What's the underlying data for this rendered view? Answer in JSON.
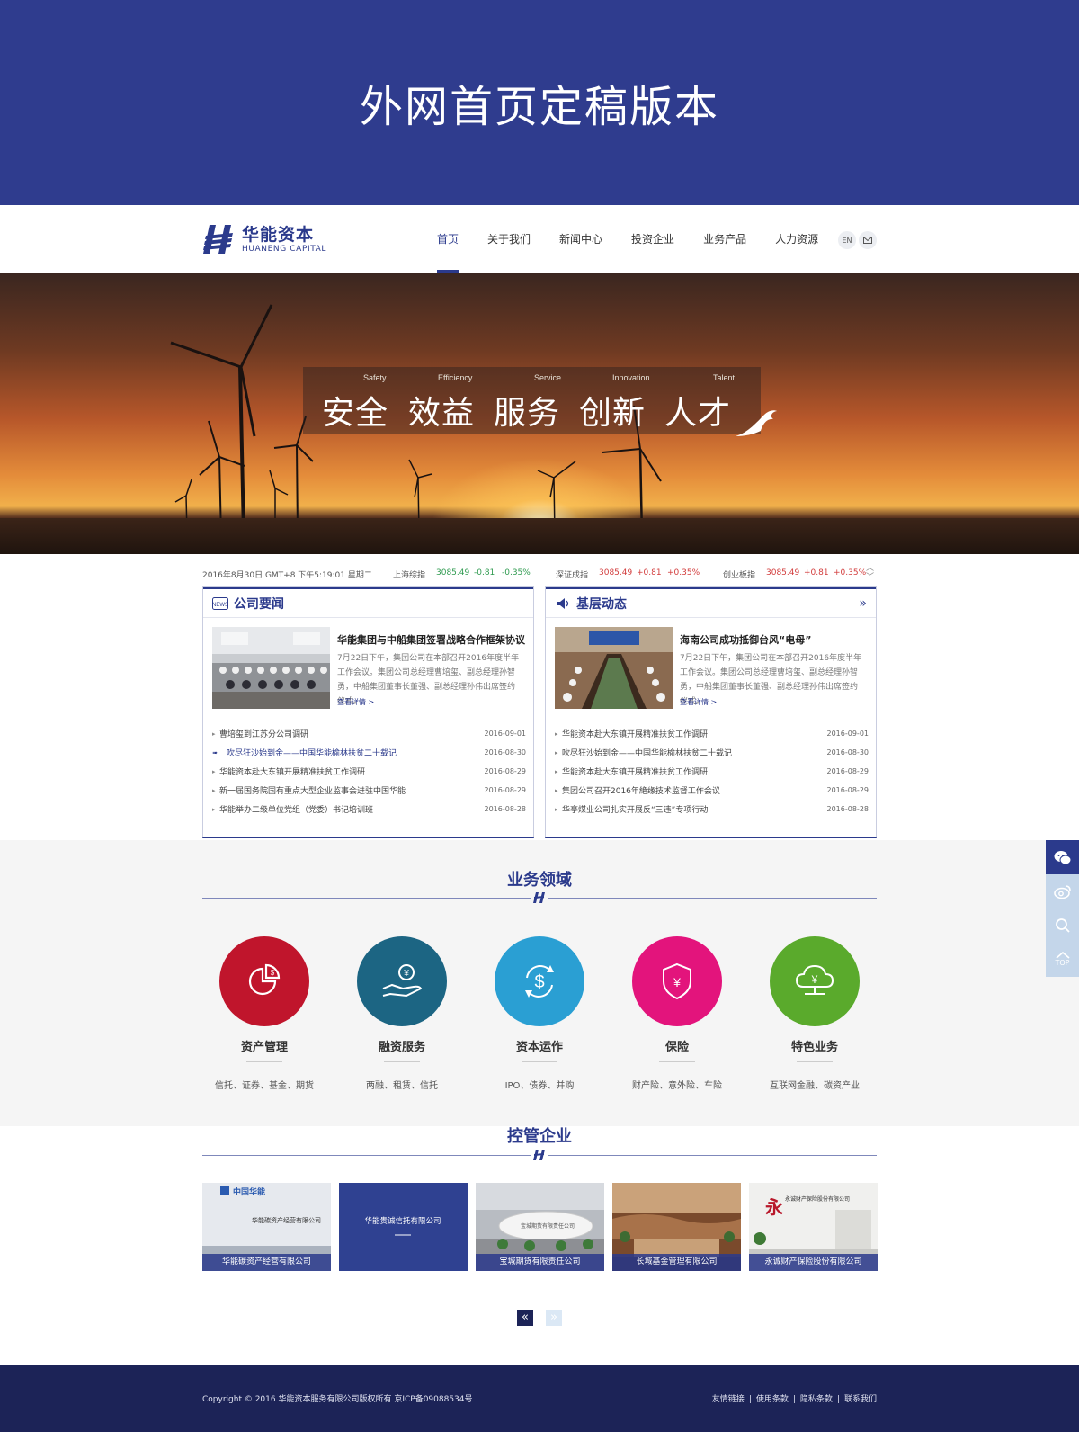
{
  "banner": {
    "title": "外网首页定稿版本"
  },
  "brand": {
    "name_cn": "华能资本",
    "name_en": "HUANENG CAPITAL",
    "color": "#2b3a8c"
  },
  "nav": {
    "items": [
      {
        "label": "首页",
        "active": true
      },
      {
        "label": "关于我们"
      },
      {
        "label": "新闻中心"
      },
      {
        "label": "投资企业"
      },
      {
        "label": "业务产品"
      },
      {
        "label": "人力资源"
      }
    ],
    "lang_label": "EN",
    "mail_icon": "mail-icon"
  },
  "hero": {
    "values": [
      {
        "en": "Safety",
        "cn": "安全"
      },
      {
        "en": "Efficiency",
        "cn": "效益"
      },
      {
        "en": "Service",
        "cn": "服务"
      },
      {
        "en": "Innovation",
        "cn": "创新"
      },
      {
        "en": "Talent",
        "cn": "人才"
      }
    ]
  },
  "ticker": {
    "datetime": "2016年8月30日  GMT+8  下午5:19:01  星期二",
    "indices": [
      {
        "name": "上海综指",
        "value": "3085.49",
        "change": "-0.81",
        "pct": "-0.35%",
        "trend": "down"
      },
      {
        "name": "深证成指",
        "value": "3085.49",
        "change": "+0.81",
        "pct": "+0.35%",
        "trend": "up"
      },
      {
        "name": "创业板指",
        "value": "3085.49",
        "change": "+0.81",
        "pct": "+0.35%",
        "trend": "up"
      }
    ]
  },
  "company_news": {
    "title": "公司要闻",
    "icon": "news-icon",
    "feature": {
      "title": "华能集团与中船集团签署战略合作框架协议",
      "body": "7月22日下午，集团公司在本部召开2016年度半年工作会议。集团公司总经理曹培玺、副总经理孙智勇，中船集团董事长董强、副总经理孙伟出席签约仪式。",
      "link": "查看详情  >"
    },
    "items": [
      {
        "title": "曹培玺到江苏分公司调研",
        "date": "2016-09-01"
      },
      {
        "title": "吹尽狂沙始到金——中国华能榆林扶贫二十载记",
        "date": "2016-08-30",
        "highlight": true
      },
      {
        "title": "华能资本赴大东镇开展精准扶贫工作调研",
        "date": "2016-08-29"
      },
      {
        "title": "新一届国务院国有重点大型企业监事会进驻中国华能",
        "date": "2016-08-29"
      },
      {
        "title": "华能举办二级单位党组（党委）书记培训班",
        "date": "2016-08-28"
      }
    ]
  },
  "grassroots_news": {
    "title": "基层动态",
    "icon": "speaker-icon",
    "more": "»",
    "feature": {
      "title": "海南公司成功抵御台风“电母”",
      "body": "7月22日下午，集团公司在本部召开2016年度半年工作会议。集团公司总经理曹培玺、副总经理孙智勇，中船集团董事长董强、副总经理孙伟出席签约仪式。",
      "link": "查看详情  >"
    },
    "items": [
      {
        "title": "华能资本赴大东镇开展精准扶贫工作调研",
        "date": "2016-09-01"
      },
      {
        "title": "吹尽狂沙始到金——中国华能榆林扶贫二十载记",
        "date": "2016-08-30"
      },
      {
        "title": "华能资本赴大东镇开展精准扶贫工作调研",
        "date": "2016-08-29"
      },
      {
        "title": "集团公司召开2016年絶缘技术监督工作会议",
        "date": "2016-08-29"
      },
      {
        "title": "华亭煤业公司扎实开展反“三违”专项行动",
        "date": "2016-08-28"
      }
    ]
  },
  "business": {
    "title": "业务领域",
    "items": [
      {
        "name": "资产管理",
        "sub": "信托、证券、基金、期货",
        "color": "#c0152c",
        "icon": "pie-chart-icon"
      },
      {
        "name": "融资服务",
        "sub": "两融、租赁、信托",
        "color": "#1c6583",
        "icon": "hand-money-icon"
      },
      {
        "name": "资本运作",
        "sub": "IPO、债券、并购",
        "color": "#2a9fd3",
        "icon": "dollar-cycle-icon"
      },
      {
        "name": "保险",
        "sub": "财产险、意外险、车险",
        "color": "#e3147c",
        "icon": "shield-yen-icon"
      },
      {
        "name": "特色业务",
        "sub": "互联网金融、碳资产业",
        "color": "#5aaa2c",
        "icon": "cloud-yen-icon"
      }
    ]
  },
  "holdings": {
    "title": "控管企业",
    "items": [
      {
        "label": "华能碳资产经营有限公司"
      },
      {
        "label": "宝城期货有限责任公司"
      },
      {
        "label": "长城基金管理有限公司"
      },
      {
        "label": "永诚财产保险股份有限公司"
      }
    ],
    "signs": [
      {
        "text": "中国华能"
      },
      {
        "text": "华能碳资产经营有限公司"
      },
      {
        "text": "华能贵诚信托有限公司"
      },
      {
        "text": "宝城期货有限责任公司"
      },
      {
        "text": "永诚财产保险股份有限公司"
      }
    ],
    "prev": "«",
    "next": "»"
  },
  "sidebar": {
    "items": [
      {
        "icon": "wechat-icon"
      },
      {
        "icon": "weibo-icon"
      },
      {
        "icon": "search-icon"
      },
      {
        "icon": "back-to-top-icon",
        "label": "TOP"
      }
    ]
  },
  "footer": {
    "copyright": "Copyright © 2016 华能资本服务有限公司版权所有 京ICP备09088534号",
    "links": [
      "友情链接",
      "使用条款",
      "隐私条款",
      "联系我们"
    ],
    "separator": "|"
  }
}
